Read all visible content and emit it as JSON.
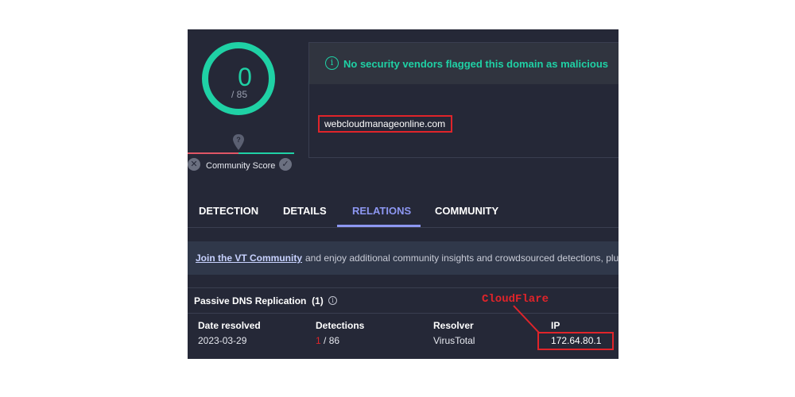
{
  "score": {
    "detections": "0",
    "total": "/ 85",
    "community_label": "Community Score"
  },
  "banner": {
    "message": "No security vendors flagged this domain as malicious"
  },
  "domain": "webcloudmanageonline.com",
  "tabs": [
    {
      "label": "DETECTION",
      "active": false
    },
    {
      "label": "DETAILS",
      "active": false
    },
    {
      "label": "RELATIONS",
      "active": true
    },
    {
      "label": "COMMUNITY",
      "active": false
    }
  ],
  "join": {
    "link": "Join the VT Community",
    "text": "and enjoy additional community insights and crowdsourced detections, plu"
  },
  "dns": {
    "title": "Passive DNS Replication",
    "count": "(1)",
    "columns": [
      "Date resolved",
      "Detections",
      "Resolver",
      "IP"
    ],
    "rows": [
      {
        "date": "2023-03-29",
        "detections_flagged": "1",
        "detections_total": " / 86",
        "resolver": "VirusTotal",
        "ip": "172.64.80.1"
      }
    ]
  },
  "annotation": {
    "label": "CloudFlare"
  },
  "colors": {
    "panel_bg": "#252837",
    "accent_green": "#1fd1a5",
    "active_tab": "#8d97f2",
    "highlight_red": "#e0242a"
  },
  "icons": [
    "info-icon",
    "community-pin-icon",
    "close-icon",
    "check-icon"
  ]
}
